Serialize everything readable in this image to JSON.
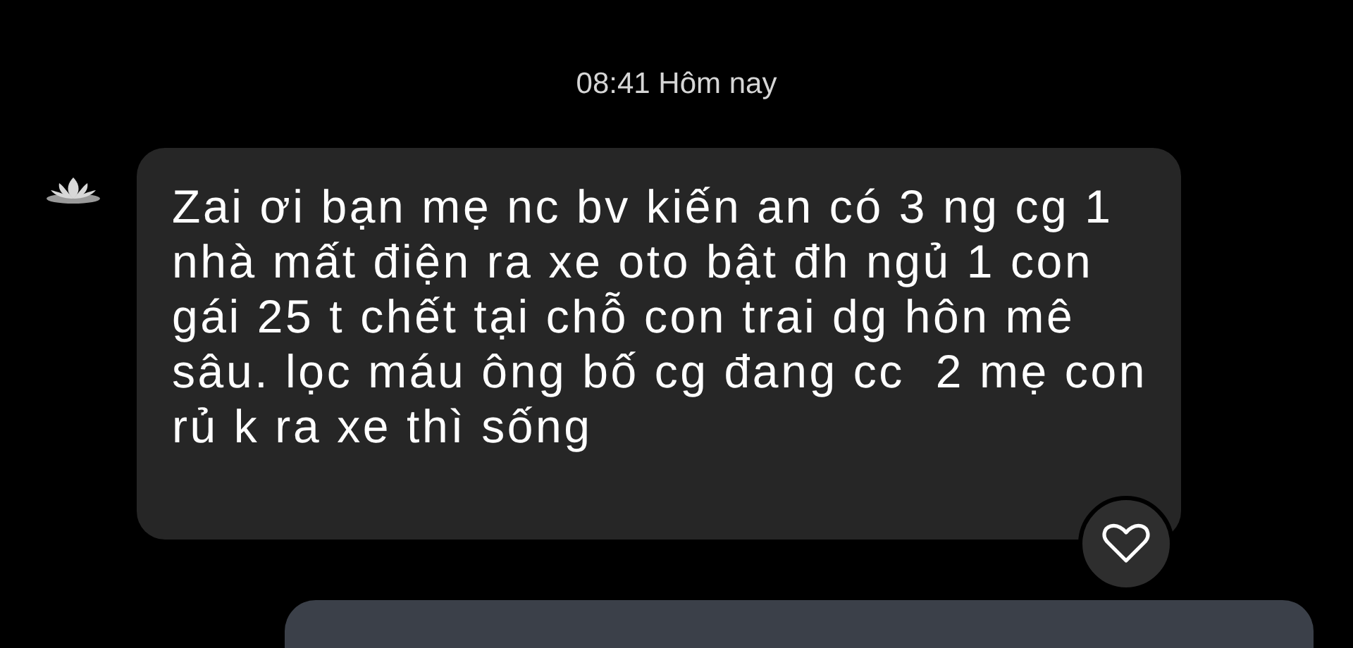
{
  "timestamp": "08:41 Hôm nay",
  "messages": [
    {
      "kind": "received",
      "text": "Zai ơi bạn mẹ nc bv kiến an có 3 ng cg 1 nhà mất điện ra xe oto bật đh ngủ 1 con gái 25 t chết tại chỗ con trai dg hôn mê sâu. lọc máu ông bố cg đang cc  2 mẹ con rủ k ra xe thì sống",
      "liked": true
    },
    {
      "kind": "sent"
    }
  ]
}
